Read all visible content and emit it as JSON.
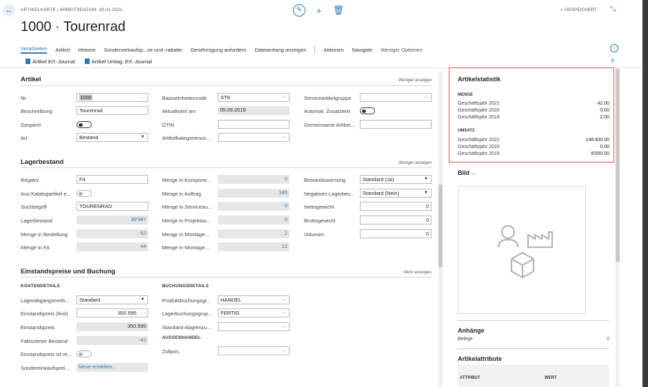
{
  "header": {
    "breadcrumb": "ARTIKELKARTE | ARBEITSDATUM: 28.01.2021",
    "title": "1000 · Tourenrad",
    "saved": "✓ GESPEICHERT"
  },
  "actions": {
    "items": [
      "Verarbeiten",
      "Artikel",
      "Historie",
      "Sonderverkaufsp...se und -rabatte",
      "Genehmigung anfordern",
      "Dateianhang anzeigen"
    ],
    "items2": [
      "Aktionen",
      "Navigate",
      "Weniger Optionen"
    ],
    "sub": [
      "Artikel Erf.-Journal",
      "Artikel Umlag. Erf.-Journal"
    ]
  },
  "artikel": {
    "title": "Artikel",
    "link": "Weniger anzeigen",
    "nr_label": "Nr.",
    "nr_value": "1000",
    "beschreibung_label": "Beschreibung",
    "beschreibung_value": "Tourenrad",
    "gesperrt_label": "Gesperrt",
    "art_label": "Art",
    "art_value": "Bestand",
    "basis_label": "Basiseinheitencode",
    "basis_value": "STK",
    "aktualisiert_label": "Aktualisiert am",
    "aktualisiert_value": "05.09.2019",
    "gtin_label": "GTIN",
    "kategorie_label": "Artikelkategorienco...",
    "service_label": "Serviceartikelgruppe",
    "zusatz_label": "Automat. Zusatztext",
    "gemeinsam_label": "Gemeinsame Artikel..."
  },
  "lager": {
    "title": "Lagerbestand",
    "link": "Weniger anzeigen",
    "regalnr_label": "Regalnr.",
    "regalnr_value": "F4",
    "katalog_label": "Aus Katalogartikel e...",
    "such_label": "Suchbegriff",
    "such_value": "TOURENRAD",
    "bestand_label": "Lagerbestand",
    "bestand_value": "39'987",
    "bestellung_label": "Menge in Bestellung",
    "bestellung_value": "62",
    "fa_label": "Menge in FA",
    "fa_value": "44",
    "kompo_label": "Menge in Kompone...",
    "kompo_value": "0",
    "auftrag_label": "Menge in Auftrag",
    "auftrag_value": "185",
    "serviceau_label": "Menge in Serviceau...",
    "serviceau_value": "0",
    "projekt_label": "Menge in Projektau...",
    "projekt_value": "0",
    "montage1_label": "Menge in Montage...",
    "montage1_value": "2",
    "montage2_label": "Menge in Montage...",
    "montage2_value": "12",
    "warnung_label": "Bestandswarnung",
    "warnung_value": "Standard (Ja)",
    "negativ_label": "Negativen Lagerbes...",
    "negativ_value": "Standard (Nein)",
    "netto_label": "Nettogewicht",
    "netto_value": "0",
    "brutto_label": "Bruttogewicht",
    "brutto_value": "0",
    "volumen_label": "Volumen",
    "volumen_value": "0"
  },
  "einstand": {
    "title": "Einstandspreise und Buchung",
    "link": "Mehr anzeigen",
    "kosten_title": "KOSTENDETAILS",
    "abgang_label": "Lagerabgangsmeth...",
    "abgang_value": "Standard",
    "fest_label": "Einstandspreis (fest)",
    "fest_value": "350.595",
    "preis_label": "Einstandspreis",
    "preis_value": "350.595",
    "fakt_label": "Fakturierter Bestand",
    "fakt_value": "-42",
    "istre_label": "Einstandspreis ist re...",
    "sonder_label": "Sondereinkaufsprei...",
    "sonder_value": "Neue erstellen...",
    "buchung_title": "BUCHUNGSDETAILS",
    "produkt_label": "Produktbuchungsgr...",
    "produkt_value": "HANDEL",
    "lagerbuch_label": "Lagerbuchungsgrup...",
    "lagerbuch_value": "FERTIG",
    "standard_label": "Standard-Abgrenzu...",
    "aussen_title": "AUSSENHANDEL",
    "zoll_label": "Zollpos."
  },
  "factbox": {
    "stat_title": "Artikelstatistik",
    "menge_title": "MENGE",
    "menge": [
      {
        "label": "Geschäftsjahr 2021",
        "value": "42.00"
      },
      {
        "label": "Geschäftsjahr 2020",
        "value": "0.00"
      },
      {
        "label": "Geschäftsjahr 2019",
        "value": "2.00"
      }
    ],
    "umsatz_title": "UMSATZ",
    "umsatz": [
      {
        "label": "Geschäftsjahr 2021",
        "value": "146'400.00"
      },
      {
        "label": "Geschäftsjahr 2020",
        "value": "0.00"
      },
      {
        "label": "Geschäftsjahr 2019",
        "value": "8'000.00"
      }
    ],
    "bild_title": "Bild",
    "anhaenge_title": "Anhänge",
    "belege_label": "Belege",
    "belege_value": "0",
    "attr_title": "Artikelattribute",
    "attr_col1": "ATTRIBUT",
    "attr_col2": "WERT"
  },
  "colors": {
    "accent": "#2a7ab0",
    "highlight": "#d9534f",
    "readonly": "#e6e6e6"
  }
}
